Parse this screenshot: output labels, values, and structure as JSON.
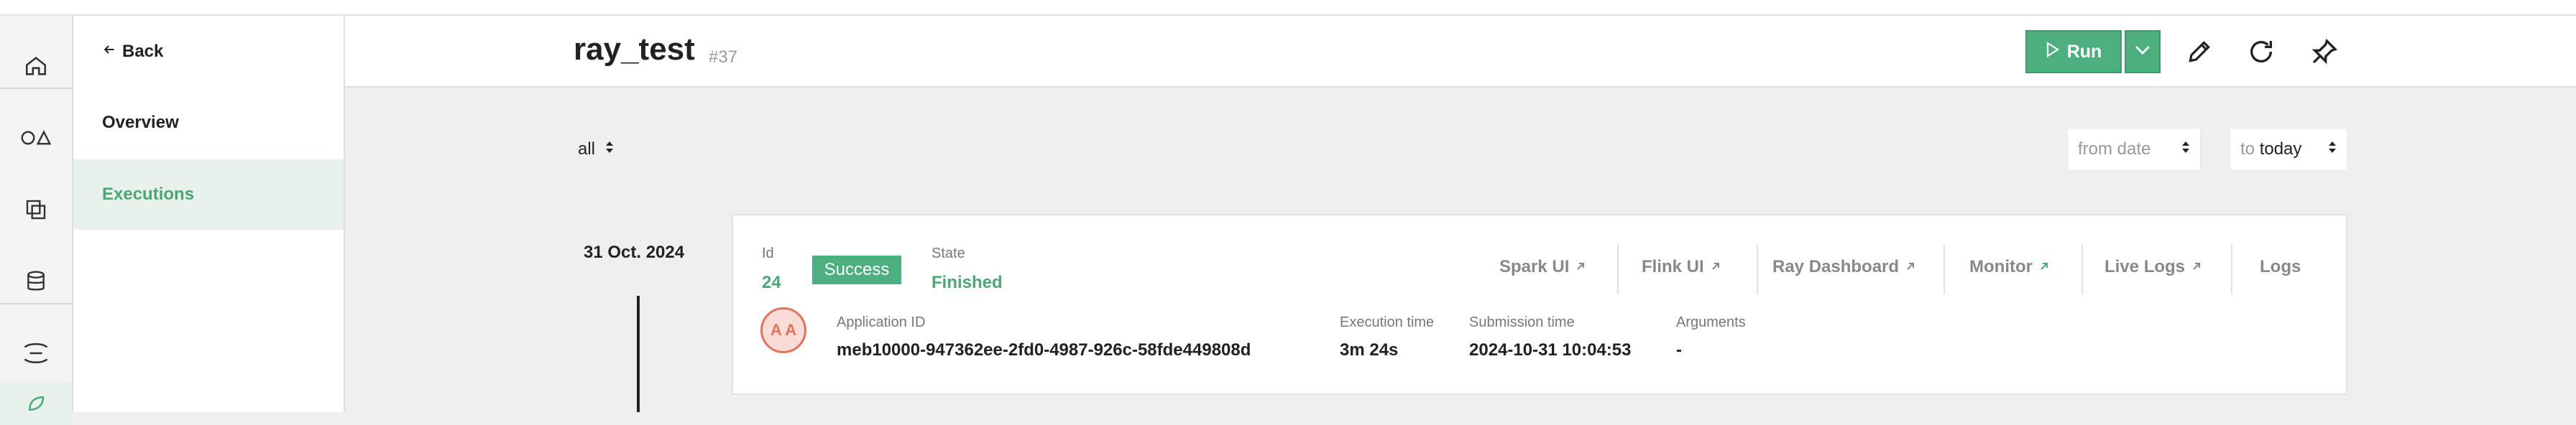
{
  "nav": {
    "back_label": "Back",
    "items": [
      {
        "label": "Overview",
        "active": false
      },
      {
        "label": "Executions",
        "active": true
      }
    ]
  },
  "header": {
    "title": "ray_test",
    "number": "#37",
    "run_label": "Run"
  },
  "filters": {
    "status_value": "all",
    "from_placeholder": "from date",
    "to_prefix": "to",
    "to_value": "today"
  },
  "execution": {
    "date": "31 Oct. 2024",
    "id_label": "Id",
    "id_value": "24",
    "status_badge": "Success",
    "state_label": "State",
    "state_value": "Finished",
    "links": [
      "Spark UI",
      "Flink UI",
      "Ray Dashboard",
      "Monitor",
      "Live Logs",
      "Logs"
    ],
    "avatar_initials": "A A",
    "app_id_label": "Application ID",
    "app_id_value": "meb10000-947362ee-2fd0-4987-926c-58fde449808d",
    "exec_time_label": "Execution time",
    "exec_time_value": "3m 24s",
    "submission_label": "Submission time",
    "submission_value": "2024-10-31 10:04:53",
    "arguments_label": "Arguments",
    "arguments_value": "-"
  },
  "colors": {
    "accent": "#4caf7d",
    "accent_text": "#4aa874",
    "avatar": "#e2725a"
  }
}
